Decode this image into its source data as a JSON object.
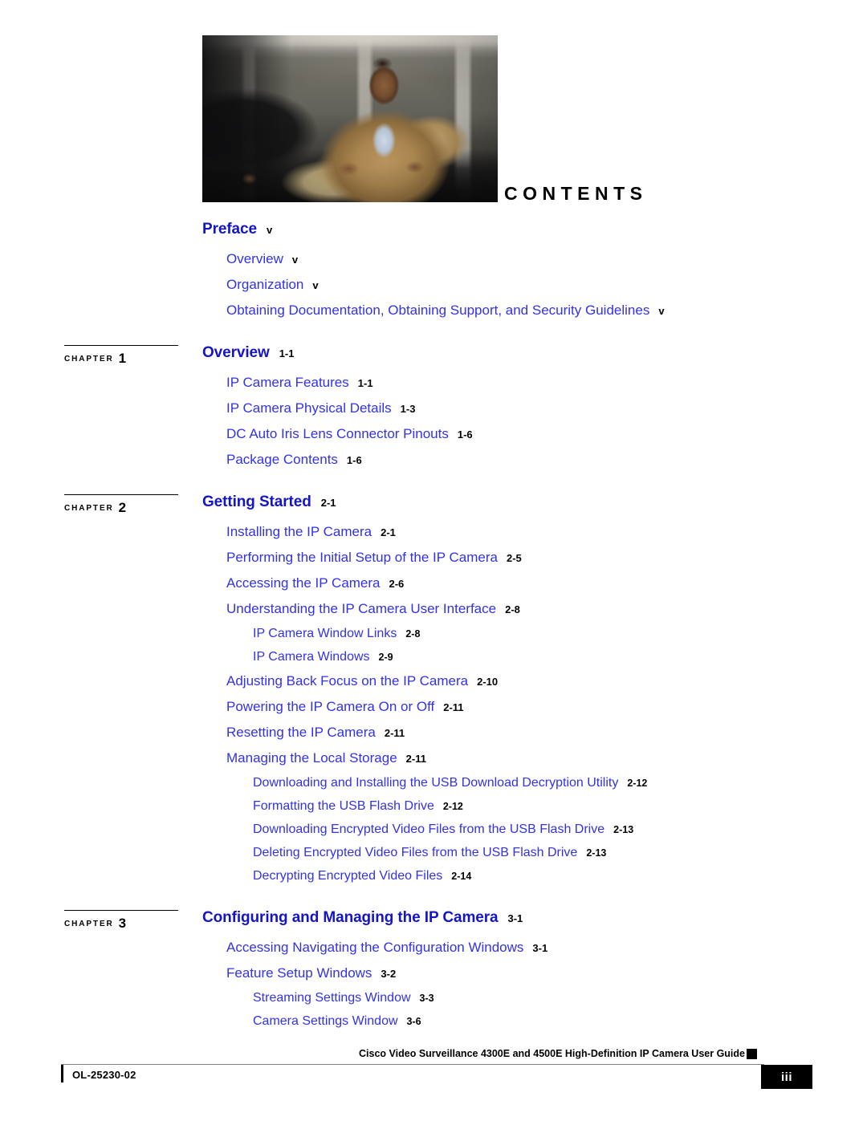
{
  "page": {
    "heading": "CONTENTS",
    "photo_alt": "cover-photo"
  },
  "toc": {
    "blocks": [
      {
        "chapter_marker": null,
        "entries": [
          {
            "level": 0,
            "label": "Preface",
            "page": "v"
          },
          {
            "level": 1,
            "label": "Overview",
            "page": "v"
          },
          {
            "level": 1,
            "label": "Organization",
            "page": "v"
          },
          {
            "level": 1,
            "label": "Obtaining Documentation, Obtaining Support, and Security Guidelines",
            "page": "v"
          }
        ]
      },
      {
        "chapter_marker": {
          "word": "CHAPTER",
          "number": "1"
        },
        "entries": [
          {
            "level": 0,
            "label": "Overview",
            "page": "1-1"
          },
          {
            "level": 1,
            "label": "IP Camera Features",
            "page": "1-1"
          },
          {
            "level": 1,
            "label": "IP Camera Physical Details",
            "page": "1-3"
          },
          {
            "level": 1,
            "label": "DC Auto Iris Lens Connector Pinouts",
            "page": "1-6"
          },
          {
            "level": 1,
            "label": "Package Contents",
            "page": "1-6"
          }
        ]
      },
      {
        "chapter_marker": {
          "word": "CHAPTER",
          "number": "2"
        },
        "entries": [
          {
            "level": 0,
            "label": "Getting Started",
            "page": "2-1"
          },
          {
            "level": 1,
            "label": "Installing the IP Camera",
            "page": "2-1"
          },
          {
            "level": 1,
            "label": "Performing the Initial Setup of the IP Camera",
            "page": "2-5"
          },
          {
            "level": 1,
            "label": "Accessing the IP Camera",
            "page": "2-6"
          },
          {
            "level": 1,
            "label": "Understanding the IP Camera User Interface",
            "page": "2-8"
          },
          {
            "level": 2,
            "label": "IP Camera Window Links",
            "page": "2-8"
          },
          {
            "level": 2,
            "label": "IP Camera Windows",
            "page": "2-9"
          },
          {
            "level": 1,
            "label": "Adjusting Back Focus on the IP Camera",
            "page": "2-10"
          },
          {
            "level": 1,
            "label": "Powering the IP Camera On or Off",
            "page": "2-11"
          },
          {
            "level": 1,
            "label": "Resetting the IP Camera",
            "page": "2-11"
          },
          {
            "level": 1,
            "label": "Managing the Local Storage",
            "page": "2-11"
          },
          {
            "level": 2,
            "label": "Downloading and Installing the USB Download Decryption Utility",
            "page": "2-12"
          },
          {
            "level": 2,
            "label": "Formatting the USB Flash Drive",
            "page": "2-12"
          },
          {
            "level": 2,
            "label": "Downloading Encrypted Video Files from the USB Flash Drive",
            "page": "2-13"
          },
          {
            "level": 2,
            "label": "Deleting Encrypted Video Files from the USB Flash Drive",
            "page": "2-13"
          },
          {
            "level": 2,
            "label": "Decrypting Encrypted Video Files",
            "page": "2-14"
          }
        ]
      },
      {
        "chapter_marker": {
          "word": "CHAPTER",
          "number": "3"
        },
        "entries": [
          {
            "level": 0,
            "label": "Configuring and Managing the IP Camera",
            "page": "3-1"
          },
          {
            "level": 1,
            "label": "Accessing Navigating the Configuration Windows",
            "page": "3-1"
          },
          {
            "level": 1,
            "label": "Feature Setup Windows",
            "page": "3-2"
          },
          {
            "level": 2,
            "label": "Streaming Settings Window",
            "page": "3-3"
          },
          {
            "level": 2,
            "label": "Camera Settings Window",
            "page": "3-6"
          }
        ]
      }
    ]
  },
  "footer": {
    "guide_title": "Cisco Video Surveillance 4300E and 4500E High-Definition IP Camera User Guide",
    "doc_id": "OL-25230-02",
    "page_number": "iii"
  },
  "colors": {
    "chapter_title_blue": "#1414C8",
    "entry_blue": "#3232E6",
    "page_number_black": "#000000"
  }
}
